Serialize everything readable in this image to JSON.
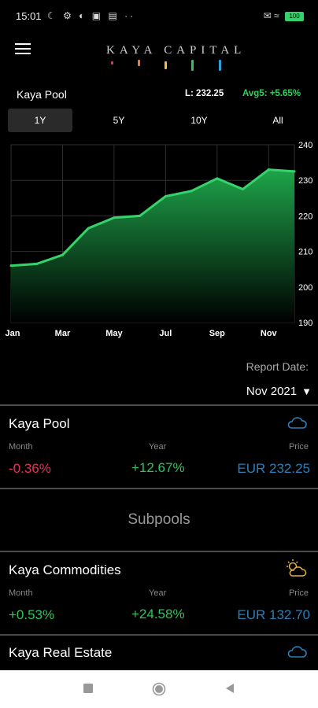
{
  "status_bar": {
    "time": "15:01",
    "left_icons": "☾ ⚙ ◐ ▣ ▤ ··",
    "right_icons": "✉ ≈",
    "battery": "100"
  },
  "header": {
    "menu_icon": "hamburger-icon",
    "logo_text": "KAYA CAPITAL",
    "logo_bar_colors": [
      "#e0345b",
      "#f07a2a",
      "#f3c13a",
      "#2fc45c",
      "#2c9fd6"
    ]
  },
  "pool": {
    "title": "Kaya Pool",
    "last": "L: 232.25",
    "avg": "Avg5: +5.65%"
  },
  "range_tabs": [
    {
      "label": "1Y",
      "active": true
    },
    {
      "label": "5Y",
      "active": false
    },
    {
      "label": "10Y",
      "active": false
    },
    {
      "label": "All",
      "active": false
    }
  ],
  "chart_data": {
    "type": "area",
    "title": "",
    "xlabel": "",
    "ylabel": "",
    "x": [
      "Jan",
      "Feb",
      "Mar",
      "Apr",
      "May",
      "Jun",
      "Jul",
      "Aug",
      "Sep",
      "Oct",
      "Nov",
      "Dec"
    ],
    "x_tick_labels": [
      "Jan",
      "Mar",
      "May",
      "Jul",
      "Sep",
      "Nov"
    ],
    "values": [
      206,
      206.5,
      209,
      216.5,
      219.5,
      220,
      225.5,
      227,
      230.5,
      227.5,
      233,
      232.5
    ],
    "ylim": [
      190,
      240
    ],
    "y_ticks": [
      190,
      200,
      210,
      220,
      230,
      240
    ],
    "y_axis_position": "right",
    "grid": true,
    "line_color": "#35d36a",
    "fill_color_top": "#1ea44a",
    "fill_color_bottom": "#000000"
  },
  "report": {
    "label": "Report Date:",
    "selected": "Nov 2021",
    "arrow": "▼"
  },
  "cards": [
    {
      "name": "Kaya Pool",
      "icon": "cloud-icon",
      "month_label": "Month",
      "month_value": "-0.36%",
      "year_label": "Year",
      "year_value": "+12.67%",
      "price_label": "Price",
      "price_value": "EUR 232.25"
    },
    {
      "name": "Kaya Commodities",
      "icon": "partly-sunny-icon",
      "month_label": "Month",
      "month_value": "+0.53%",
      "year_label": "Year",
      "year_value": "+24.58%",
      "price_label": "Price",
      "price_value": "EUR 132.70"
    },
    {
      "name": "Kaya Real Estate",
      "icon": "cloud-icon"
    }
  ],
  "subpools_heading": "Subpools",
  "nav": {
    "recents": "square-icon",
    "home": "circle-icon",
    "back": "triangle-back-icon"
  }
}
